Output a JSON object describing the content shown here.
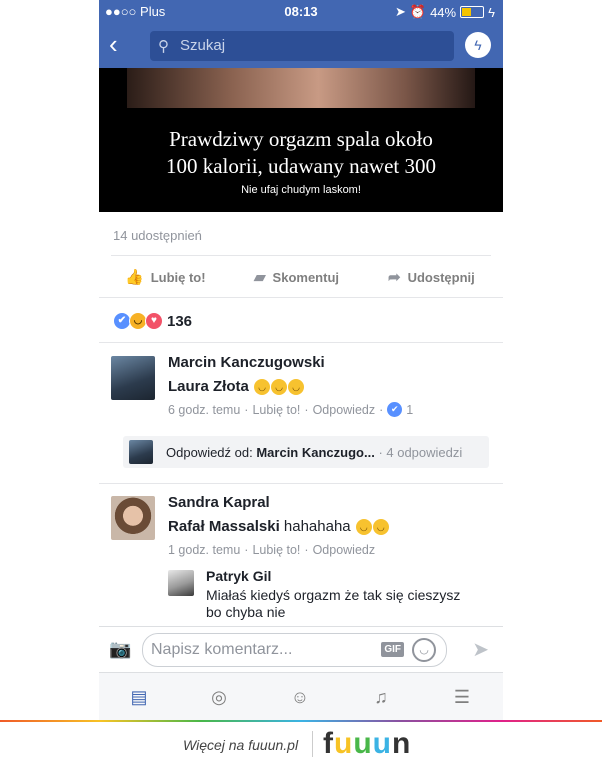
{
  "status_bar": {
    "carrier": "●●○○ Plus",
    "time": "08:13",
    "battery": "44%",
    "battery_level": 0.44
  },
  "navbar": {
    "search_placeholder": "Szukaj"
  },
  "post": {
    "headline_line1": "Prawdziwy orgazm spala około",
    "headline_line2": "100 kalorii, udawany nawet 300",
    "subline": "Nie ufaj chudym laskom!",
    "shares": "14 udostępnień",
    "actions": {
      "like": "Lubię to!",
      "comment": "Skomentuj",
      "share": "Udostępnij"
    },
    "reaction_count": "136"
  },
  "comments": [
    {
      "author": "Marcin Kanczugowski",
      "mention": "Laura Złota",
      "text": "",
      "time": "6 godz. temu",
      "like": "Lubię to!",
      "reply": "Odpowiedz",
      "likes": "1",
      "reply_preview": {
        "prefix": "Odpowiedź od: ",
        "author": "Marcin Kanczugo...",
        "count": "· 4 odpowiedzi"
      }
    },
    {
      "author": "Sandra Kapral",
      "mention": "Rafał Massalski",
      "text": "hahahaha",
      "time": "1 godz. temu",
      "like": "Lubię to!",
      "reply": "Odpowiedz"
    }
  ],
  "nested_reply": {
    "author": "Patryk Gil",
    "text_line1": "Miałaś kiedyś orgazm że tak się cieszysz",
    "text_line2": "bo chyba nie"
  },
  "composer": {
    "placeholder": "Napisz komentarz...",
    "gif": "GIF"
  },
  "footer": {
    "text": "Więcej na fuuun.pl",
    "logo": [
      "f",
      "u",
      "u",
      "u",
      "n"
    ],
    "logo_colors": [
      "#333333",
      "#f7c325",
      "#49b749",
      "#3bb3e4",
      "#333333"
    ]
  },
  "colors": {
    "brand": "#4267b2",
    "like": "#5890ff"
  }
}
